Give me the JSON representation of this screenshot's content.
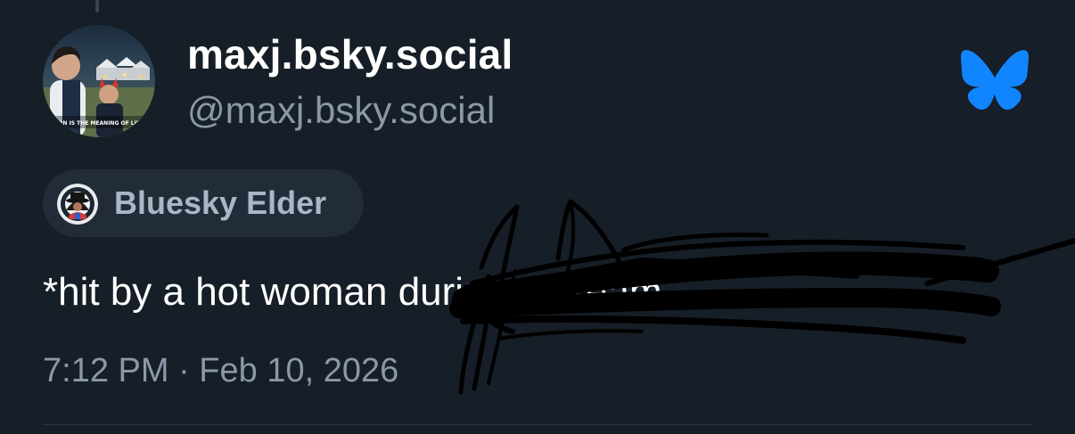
{
  "post": {
    "display_name": "maxj.bsky.social",
    "handle": "@maxj.bsky.social",
    "avatar_caption": "SON IS THE MEANING OF LIFE",
    "badge": {
      "label": "Bluesky Elder",
      "icon": "elder-badge-icon"
    },
    "text_visible": "*hit by a hot woman",
    "text_redacted": "during a dream",
    "timestamp": "7:12 PM · Feb 10, 2026"
  },
  "icons": {
    "logo": "butterfly-icon"
  },
  "colors": {
    "background": "#161e27",
    "accent": "#1185fe",
    "muted_text": "#8b98a8",
    "badge_bg": "#222c38",
    "badge_text": "#aab6c4"
  }
}
